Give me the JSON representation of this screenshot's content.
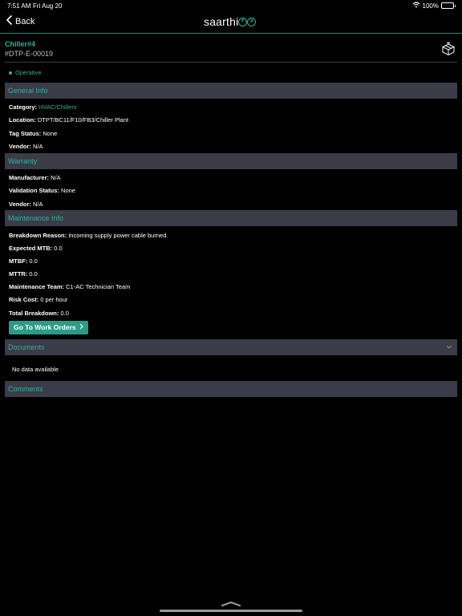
{
  "status_bar": {
    "time": "7:51 AM",
    "date": "Fri Aug 20",
    "battery": "100%"
  },
  "nav": {
    "back_label": "Back",
    "logo_text": "saarthi",
    "logo_badge": "FX"
  },
  "asset": {
    "title": "Chiller#4",
    "code": "#DTP-E-00019",
    "status": "Operative"
  },
  "sections": {
    "general": {
      "title": "General Info",
      "fields": [
        {
          "label": "Category:",
          "value": "HVAC/Chillers"
        },
        {
          "label": "Location:",
          "value": "DTPT/BC11/F10/FB3/Chiller Plant"
        },
        {
          "label": "Tag Status:",
          "value": "None"
        },
        {
          "label": "Vendor:",
          "value": "N/A"
        }
      ]
    },
    "warranty": {
      "title": "Warranty",
      "fields": [
        {
          "label": "Manufacturer:",
          "value": "N/A"
        },
        {
          "label": "Validation Status:",
          "value": "None"
        },
        {
          "label": "Vendor:",
          "value": "N/A"
        }
      ]
    },
    "maintenance": {
      "title": "Maintenance Info",
      "fields": [
        {
          "label": "Breakdown Reason:",
          "value": "Incoming supply power cable burned"
        },
        {
          "label": "Expected MTB:",
          "value": "0.0"
        },
        {
          "label": "MTBF:",
          "value": "0.0"
        },
        {
          "label": "MTTR:",
          "value": "0.0"
        },
        {
          "label": "Maintenance Team:",
          "value": "C1-AC Technician Team"
        },
        {
          "label": "Risk Cost:",
          "value": "0 per hour"
        },
        {
          "label": "Total Breakdown:",
          "value": "0.0"
        }
      ],
      "button_label": "Go To Work Orders"
    },
    "documents": {
      "title": "Documents",
      "empty_text": "No data available"
    },
    "comments": {
      "title": "Comments"
    }
  },
  "colors": {
    "accent": "#2fb09a",
    "section_bg": "#3b3c47",
    "background": "#000000"
  },
  "icons": [
    "chevron-left-icon",
    "wifi-icon",
    "battery-icon",
    "package-box-icon",
    "chevron-right-icon",
    "chevron-down-icon",
    "chevron-up-icon"
  ]
}
